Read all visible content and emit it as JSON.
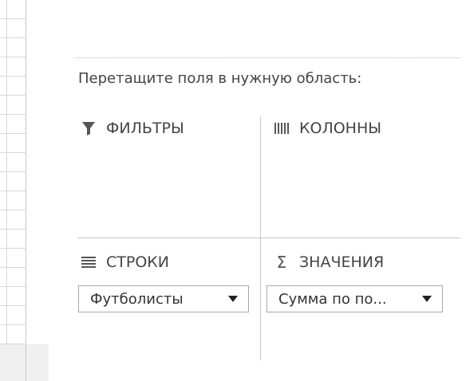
{
  "instruction": "Перетащите поля в нужную область:",
  "areas": {
    "filters": {
      "label": "ФИЛЬТРЫ",
      "icon": "filter-icon"
    },
    "columns": {
      "label": "КОЛОННЫ",
      "icon": "columns-icon"
    },
    "rows": {
      "label": "СТРОКИ",
      "icon": "rows-icon"
    },
    "values": {
      "label": "ЗНАЧЕНИЯ",
      "icon": "sigma-icon"
    }
  },
  "fields": {
    "rows_field": "Футболисты",
    "values_field": "Сумма по по..."
  },
  "colors": {
    "border": "#a9a9a9",
    "divider": "#c6c6c6",
    "text": "#444444"
  }
}
